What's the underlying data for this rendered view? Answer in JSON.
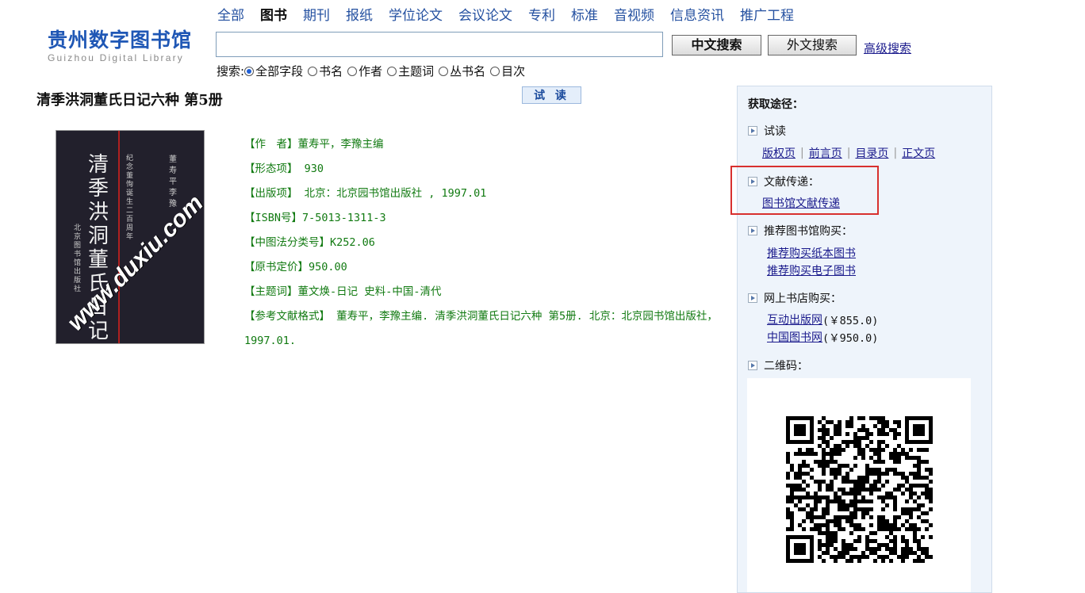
{
  "logo": {
    "cn": "贵州数字图书馆",
    "en": "Guizhou Digital Library"
  },
  "nav": {
    "items": [
      "全部",
      "图书",
      "期刊",
      "报纸",
      "学位论文",
      "会议论文",
      "专利",
      "标准",
      "音视频",
      "信息资讯",
      "推广工程"
    ],
    "active": "图书"
  },
  "search": {
    "value": "",
    "cn_button": "中文搜索",
    "foreign_button": "外文搜索",
    "advanced": "高级搜索"
  },
  "scope": {
    "label": "搜索:",
    "options": [
      "全部字段",
      "书名",
      "作者",
      "主题词",
      "丛书名",
      "目次"
    ],
    "selected": "全部字段"
  },
  "book": {
    "title": "清季洪洞董氏日记六种  第5册",
    "read_button": "试 读",
    "cover": {
      "title": "清季洪洞董氏日记六",
      "subtitle": "纪念董恂诞生二百周年",
      "authors": "董寿平 李豫",
      "publisher": "北京图书馆出版社",
      "watermark": "www.duxiu.com"
    },
    "meta": [
      "【作　者】董寿平，李豫主编",
      "【形态项】 930",
      "【出版项】 北京：北京园书馆出版社 , 1997.01",
      "【ISBN号】7-5013-1311-3",
      "【中图法分类号】K252.06",
      "【原书定价】950.00",
      "【主题词】董文焕-日记 史料-中国-清代",
      "【参考文献格式】 董寿平，李豫主编. 清季洪洞董氏日记六种 第5册. 北京：北京园书馆出版社，1997.01."
    ]
  },
  "panel": {
    "heading": "获取途径：",
    "trial": {
      "label": "试读",
      "links": [
        "版权页",
        "前言页",
        "目录页",
        "正文页"
      ]
    },
    "delivery": {
      "label": "文献传递：",
      "link": "图书馆文献传递"
    },
    "recommend": {
      "label": "推荐图书馆购买：",
      "links": [
        "推荐购买纸本图书",
        "推荐购买电子图书"
      ]
    },
    "online": {
      "label": "网上书店购买：",
      "stores": [
        {
          "name": "互动出版网",
          "price": "(￥855.0)"
        },
        {
          "name": "中国图书网",
          "price": "(￥950.0)"
        }
      ]
    },
    "qrcode": {
      "label": "二维码："
    }
  },
  "colors": {
    "nav_link": "#2450a0",
    "meta_text": "#117a11",
    "panel_bg": "#eef4fb",
    "highlight": "#d8302e"
  }
}
